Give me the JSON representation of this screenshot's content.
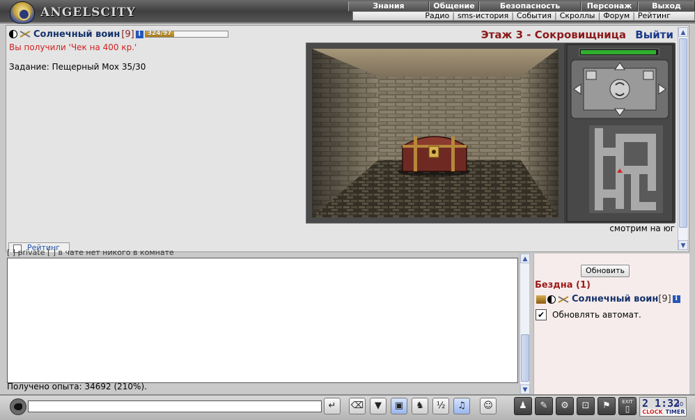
{
  "header": {
    "logo_text": "ANGELSCITY",
    "menu": [
      "Знания",
      "Общение",
      "Безопасность",
      "Персонаж",
      "Выход"
    ],
    "submenu": [
      "Радио",
      "sms-история",
      "События",
      "Скроллы",
      "Форум",
      "Рейтинг"
    ]
  },
  "player": {
    "name": "Солнечный воин",
    "level": "[9]",
    "hp_text": "324/97",
    "hp_fraction": 0.35
  },
  "messages": {
    "received": "Вы получили 'Чек на 400 кр.'",
    "quest": "Задание: Пещерный Мох 35/30"
  },
  "location": {
    "floor_title": "Этаж 3 - Сокровищница",
    "exit_label": "Выйти",
    "facing": "смотрим на юг"
  },
  "tabs": {
    "rating": "Рейтинг"
  },
  "chat": {
    "strip_text": "[ ] private [ ] в чате нет никого в комнате",
    "exp_line": "Получено опыта: 34692 (210%)."
  },
  "room_panel": {
    "refresh_label": "Обновить",
    "room_name": "Бездна (1)",
    "player_name": "Солнечный воин",
    "player_level": "[9]",
    "auto_refresh_label": "Обновлять автомат.",
    "auto_refresh_checked": "✔"
  },
  "toolbar": {
    "input_value": "",
    "clock_time": "2 1:32",
    "clock_seconds": "40",
    "clock_label": "CLOCK",
    "timer_label": "TIMER",
    "exit_label": "EXIT"
  },
  "icons": {
    "speak": "speak-icon",
    "enter": "enter-icon",
    "clear": "eraser-icon",
    "filter": "filter-icon",
    "save": "floppy-icon",
    "run": "running-man-icon",
    "translit": "translit-icon",
    "music": "music-icon",
    "smile": "smile-icon"
  },
  "colors": {
    "player_name": "#14316a",
    "level": "#8b2020",
    "message_red": "#d42020",
    "floor_title": "#8b1a1a",
    "exit_link": "#1a3a8a",
    "right_panel_bg": "#f7ecec"
  }
}
